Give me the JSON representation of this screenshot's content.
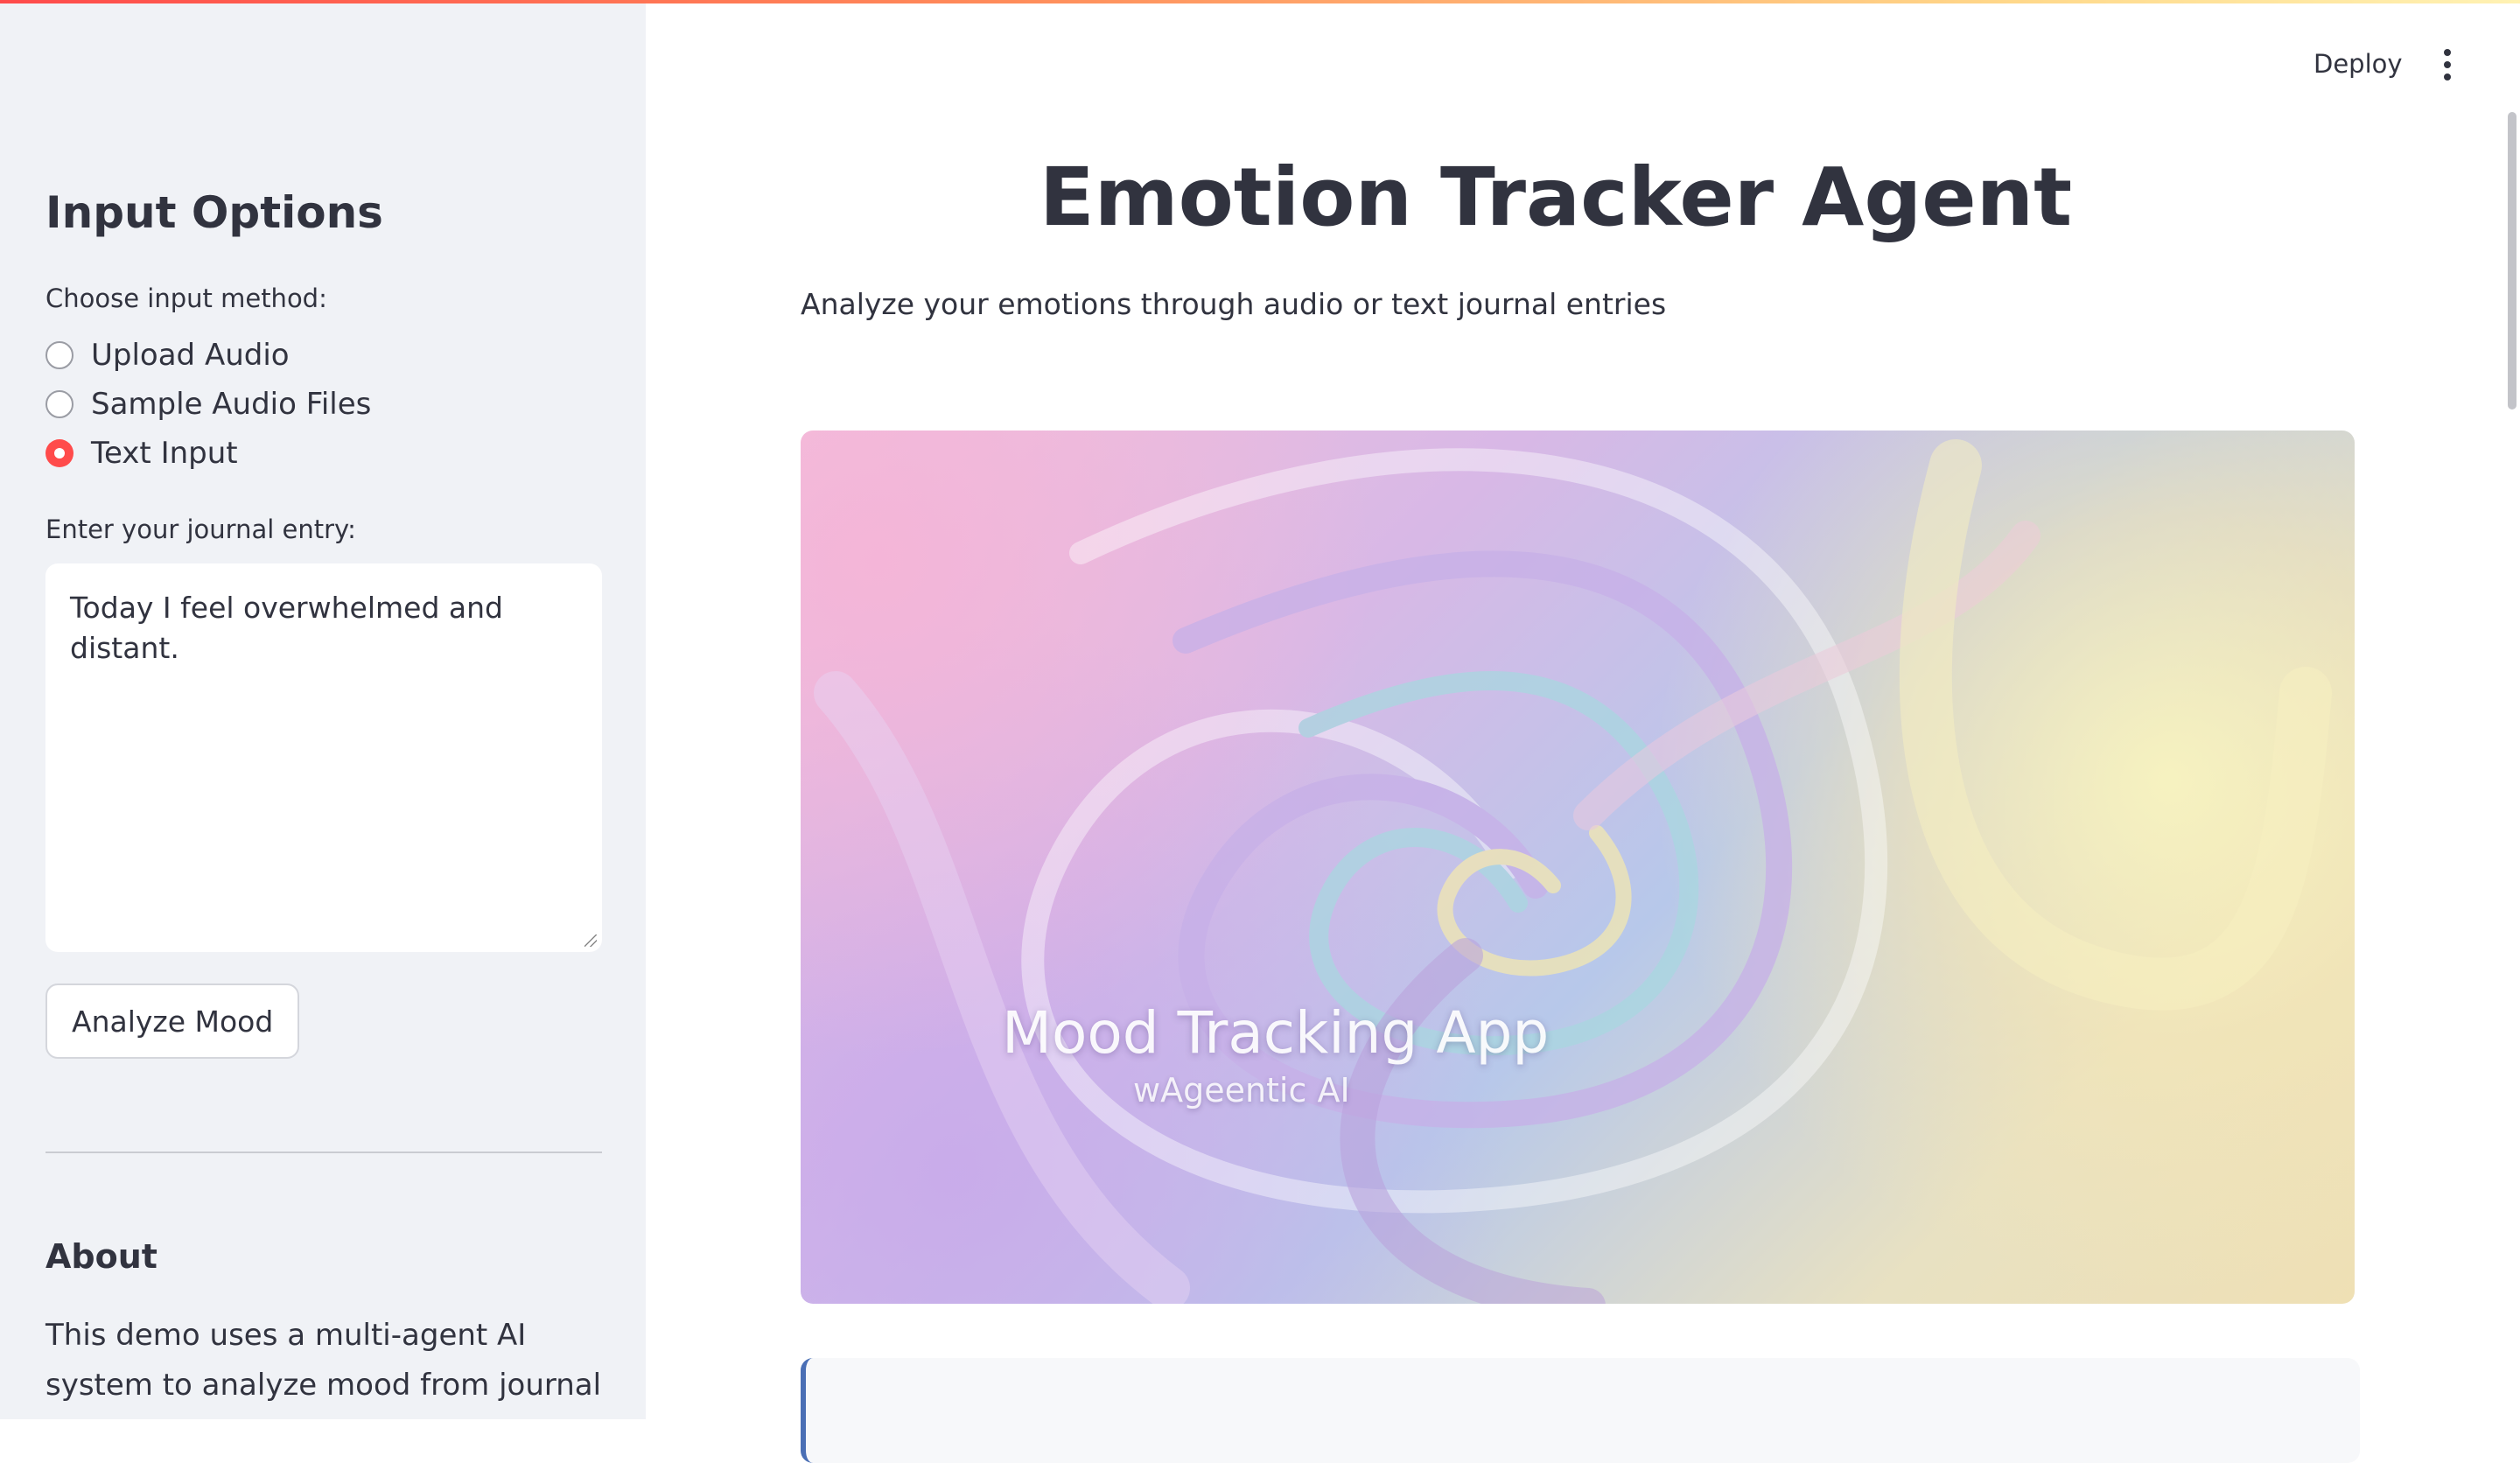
{
  "app": {
    "deploy_label": "Deploy",
    "title": "Emotion Tracker Agent",
    "subtitle": "Analyze your emotions through audio or text journal entries"
  },
  "sidebar": {
    "heading": "Input Options",
    "radio_group_label": "Choose input method:",
    "radio_options": [
      {
        "label": "Upload Audio",
        "checked": false
      },
      {
        "label": "Sample Audio Files",
        "checked": false
      },
      {
        "label": "Text Input",
        "checked": true
      }
    ],
    "journal_label": "Enter your journal entry:",
    "journal_value": "Today I feel overwhelmed and distant.",
    "analyze_button": "Analyze Mood",
    "about_heading": "About",
    "about_text": "This demo uses a multi-agent AI system to analyze mood from journal entries and"
  },
  "hero": {
    "title": "Mood Tracking App",
    "subtitle": "wAgeentic AI"
  },
  "colors": {
    "accent": "#ff4b4b",
    "sidebar_bg": "#f0f2f6",
    "text": "#31333f",
    "info_border": "#4a6fb5"
  }
}
